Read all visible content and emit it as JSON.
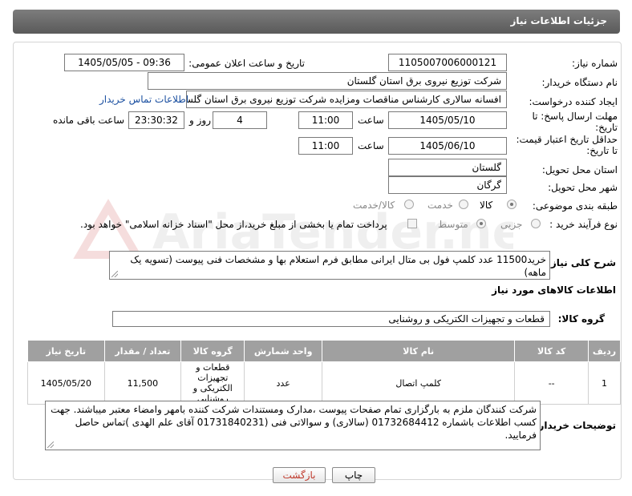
{
  "header": {
    "title": "جزئیات اطلاعات نیاز"
  },
  "fields": {
    "need_number": {
      "label": "شماره نیاز:",
      "value": "1105007006000121"
    },
    "announce": {
      "label": "تاریخ و ساعت اعلان عمومی:",
      "value": "1405/05/05 - 09:36"
    },
    "buyer_org": {
      "label": "نام دستگاه خریدار:",
      "value": "شرکت توزیع نیروی برق استان گلستان"
    },
    "requester": {
      "label": "ایجاد کننده درخواست:",
      "value": "افسانه سالاری کارشناس مناقصات ومزایده شرکت توزیع نیروی برق استان گلستان",
      "contact_link": "اطلاعات تماس خریدار"
    },
    "reply_deadline": {
      "label": "مهلت ارسال پاسخ: تا تاریخ:",
      "date": "1405/05/10",
      "time_label": "ساعت",
      "time": "11:00",
      "days": "4",
      "days_label": "روز و",
      "remaining": "23:30:32",
      "remaining_label": "ساعت باقی مانده"
    },
    "price_validity": {
      "label": "حداقل تاریخ اعتبار قیمت: تا تاریخ:",
      "date": "1405/06/10",
      "time_label": "ساعت",
      "time": "11:00"
    },
    "province": {
      "label": "استان محل تحویل:",
      "value": "گلستان"
    },
    "city": {
      "label": "شهر محل تحویل:",
      "value": "گرگان"
    },
    "category": {
      "label": "طبقه بندی موضوعی:",
      "options": [
        "کالا",
        "خدمت",
        "کالا/خدمت"
      ],
      "selected": "کالا"
    },
    "process": {
      "label": "نوع فرآیند خرید :",
      "options": [
        "جزیی",
        "متوسط"
      ],
      "selected": "متوسط",
      "payment_note": "پرداخت تمام یا بخشی از مبلغ خرید،از محل \"اسناد خزانه اسلامی\" خواهد بود."
    }
  },
  "description": {
    "label": "شرح کلی نیاز:",
    "text": "خرید11500 عدد کلمپ فول بی متال ایرانی مطابق فرم استعلام بها و مشخصات فنی پیوست (تسویه یک ماهه)"
  },
  "goods_section": {
    "title": "اطلاعات کالاهای مورد نیاز",
    "group_label": "گروه کالا:",
    "group_value": "قطعات و تجهیزات الکتریکی و روشنایی"
  },
  "table": {
    "headers": [
      "ردیف",
      "کد کالا",
      "نام کالا",
      "واحد شمارش",
      "گروه کالا",
      "تعداد / مقدار",
      "تاریخ نیاز"
    ],
    "rows": [
      [
        "1",
        "--",
        "کلمپ اتصال",
        "عدد",
        "قطعات و تجهیزات الکتریکی و روشنایی",
        "11,500",
        "1405/05/20"
      ]
    ]
  },
  "buyer_notes": {
    "label": "توضیحات خریدار:",
    "text": "شرکت کنندگان ملزم به بارگزاری تمام صفحات پیوست ،مدارک ومستندات شرکت کننده بامهر وامضاء معتبر میباشند. جهت کسب اطلاعات باشماره 01732684412 (سالاری) و سوالاتی فنی (01731840231 آقای علم الهدی )تماس حاصل فرمایید."
  },
  "buttons": {
    "print": "چاپ",
    "back": "بازگشت"
  },
  "watermark": {
    "text": "AriaTender.net"
  },
  "colors": {
    "header_bg": "#6b6b6b",
    "table_header_bg": "#a0a0a0",
    "link": "#1a4fa0",
    "back_button_text": "#c0392b"
  }
}
